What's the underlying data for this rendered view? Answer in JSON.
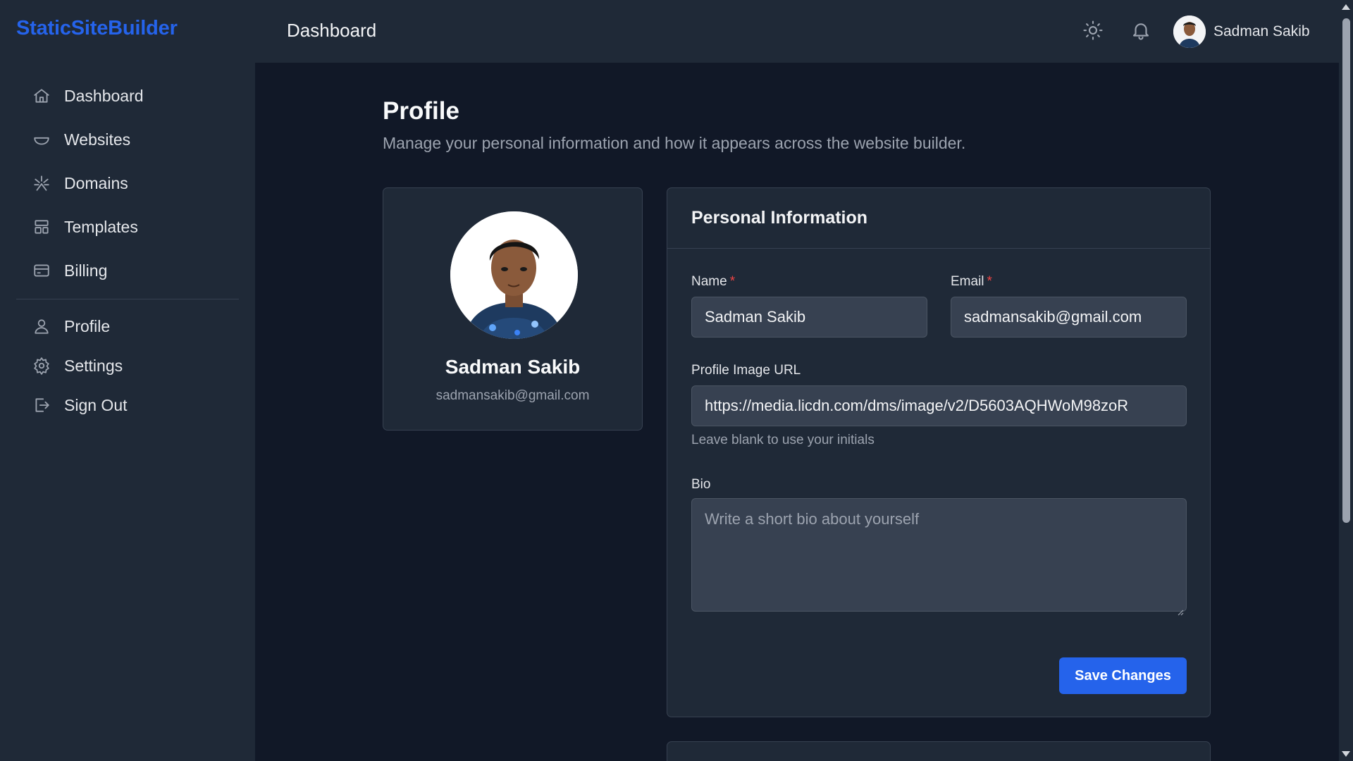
{
  "sidebar": {
    "brand": "StaticSiteBuilder",
    "items": [
      {
        "label": "Dashboard",
        "icon": "home-icon"
      },
      {
        "label": "Websites",
        "icon": "bowl-icon"
      },
      {
        "label": "Domains",
        "icon": "sparkle-icon"
      },
      {
        "label": "Templates",
        "icon": "template-icon"
      },
      {
        "label": "Billing",
        "icon": "credit-card-icon"
      }
    ],
    "account_items": [
      {
        "label": "Profile",
        "icon": "user-icon"
      },
      {
        "label": "Settings",
        "icon": "gear-icon"
      },
      {
        "label": "Sign Out",
        "icon": "sign-out-icon"
      }
    ]
  },
  "header": {
    "title": "Dashboard",
    "user_name": "Sadman Sakib"
  },
  "page": {
    "title": "Profile",
    "subtitle": "Manage your personal information and how it appears across the website builder."
  },
  "profile_card": {
    "name": "Sadman Sakib",
    "email": "sadmansakib@gmail.com"
  },
  "form": {
    "title": "Personal Information",
    "name_label": "Name",
    "name_value": "Sadman Sakib",
    "email_label": "Email",
    "email_value": "sadmansakib@gmail.com",
    "required_mark": "*",
    "image_url_label": "Profile Image URL",
    "image_url_value": "https://media.licdn.com/dms/image/v2/D5603AQHWoM98zoR",
    "image_url_hint": "Leave blank to use your initials",
    "bio_label": "Bio",
    "bio_placeholder": "Write a short bio about yourself",
    "save_label": "Save Changes"
  },
  "colors": {
    "accent": "#2563eb",
    "background": "#111827",
    "surface": "#1f2937",
    "required": "#ef4444"
  }
}
